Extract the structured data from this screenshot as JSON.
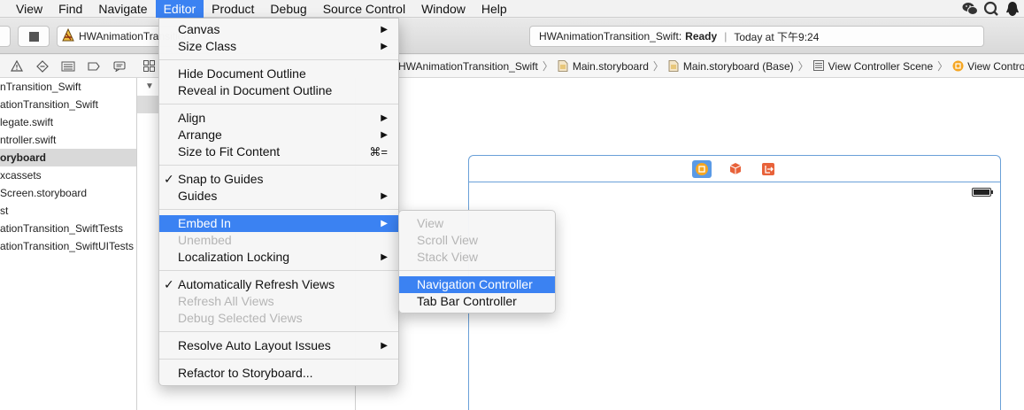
{
  "menubar": {
    "items": [
      "View",
      "Find",
      "Navigate",
      "Editor",
      "Product",
      "Debug",
      "Source Control",
      "Window",
      "Help"
    ],
    "active_index": 3,
    "status_icons": [
      "wechat-icon",
      "qq-search-icon",
      "qq-penguin-icon"
    ]
  },
  "toolbar": {
    "scheme_label": "HWAnimationTransition_Swift",
    "activity_project": "HWAnimationTransition_Swift:",
    "activity_state": "Ready",
    "activity_separator": "|",
    "activity_time": "Today at 下午9:24"
  },
  "navigator": {
    "rows": [
      "nTransition_Swift",
      "ationTransition_Swift",
      "legate.swift",
      "ntroller.swift",
      "oryboard",
      "xcassets",
      "Screen.storyboard",
      "st",
      "ationTransition_SwiftTests",
      "ationTransition_SwiftUITests"
    ],
    "selected_index": 4
  },
  "jumpbar": {
    "crumbs": [
      "HWAnimationTransition_Swift",
      "Main.storyboard",
      "Main.storyboard (Base)",
      "View Controller Scene",
      "View Controller"
    ],
    "separator": "〉"
  },
  "editor_menu": {
    "canvas": "Canvas",
    "size_class": "Size Class",
    "hide_document_outline": "Hide Document Outline",
    "reveal_in_document_outline": "Reveal in Document Outline",
    "align": "Align",
    "arrange": "Arrange",
    "size_to_fit": "Size to Fit Content",
    "size_to_fit_shortcut": "⌘=",
    "snap_to_guides": "Snap to Guides",
    "guides": "Guides",
    "embed_in": "Embed In",
    "unembed": "Unembed",
    "localization_locking": "Localization Locking",
    "auto_refresh_views": "Automatically Refresh Views",
    "refresh_all_views": "Refresh All Views",
    "debug_selected_views": "Debug Selected Views",
    "resolve_auto_layout": "Resolve Auto Layout Issues",
    "refactor_to_storyboard": "Refactor to Storyboard...",
    "check": "✓",
    "arrow": "▶"
  },
  "embed_submenu": {
    "view": "View",
    "scroll_view": "Scroll View",
    "stack_view": "Stack View",
    "navigation_controller": "Navigation Controller",
    "tab_bar_controller": "Tab Bar Controller"
  },
  "colors": {
    "highlight": "#3b82f2",
    "scene_border": "#6aa0d8",
    "vc_icon": "#f5a623",
    "first_responder": "#e8623a",
    "exit_icon": "#e8623a"
  }
}
